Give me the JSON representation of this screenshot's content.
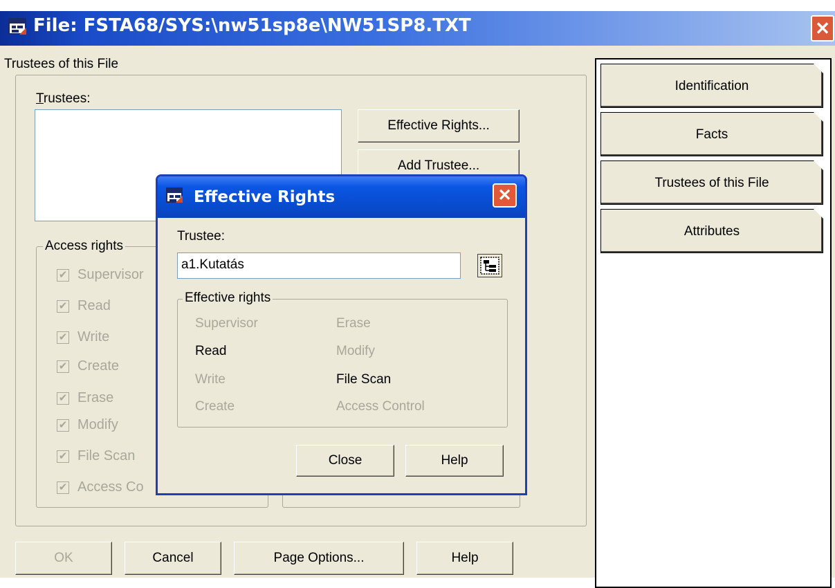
{
  "window": {
    "title": "File: FSTA68/SYS:\\nw51sp8e\\NW51SP8.TXT",
    "close_glyph": "✕"
  },
  "trustees_page": {
    "heading": "Trustees of this File",
    "trustees_label": "Trustees:",
    "buttons": {
      "effective_rights": "Effective Rights...",
      "add_trustee": "Add Trustee..."
    },
    "access_rights": {
      "legend": "Access rights",
      "items": [
        "Supervisor",
        "Read",
        "Write",
        "Create",
        "Erase",
        "Modify",
        "File Scan",
        "Access Co"
      ],
      "checked": true
    }
  },
  "tabs": [
    {
      "label": "Identification"
    },
    {
      "label": "Facts"
    },
    {
      "label": "Trustees of this File"
    },
    {
      "label": "Attributes"
    }
  ],
  "bottom_buttons": {
    "ok": "OK",
    "cancel": "Cancel",
    "page_options": "Page Options...",
    "help": "Help"
  },
  "effective_rights_dialog": {
    "title": "Effective Rights",
    "trustee_label": "Trustee:",
    "trustee_value": "a1.Kutatás",
    "rights_legend": "Effective rights",
    "rights": [
      {
        "label": "Supervisor",
        "enabled": false
      },
      {
        "label": "Erase",
        "enabled": false
      },
      {
        "label": "Read",
        "enabled": true
      },
      {
        "label": "Modify",
        "enabled": false
      },
      {
        "label": "Write",
        "enabled": false
      },
      {
        "label": "File Scan",
        "enabled": true
      },
      {
        "label": "Create",
        "enabled": false
      },
      {
        "label": "Access Control",
        "enabled": false
      }
    ],
    "close_button": "Close",
    "help_button": "Help",
    "close_glyph": "✕"
  },
  "icons": {
    "app": "netware-file-icon",
    "browse": "browse-tree-icon"
  },
  "colors": {
    "title_blue": "#0a56e3",
    "dialog_face": "#ece9d8",
    "close_red": "#e2593a",
    "disabled_text": "#a9a79b"
  }
}
